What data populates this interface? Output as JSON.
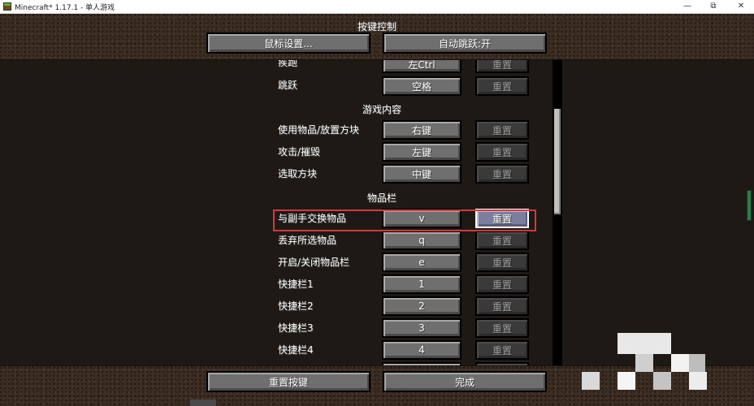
{
  "window": {
    "title": "Minecraft* 1.17.1 - 单人游戏",
    "minimize_glyph": "—",
    "maximize_glyph": "⧉",
    "close_glyph": "✕"
  },
  "screen": {
    "title": "按键控制",
    "mouse_settings_button": "鼠标设置...",
    "auto_jump_button": "自动跳跃:开"
  },
  "keybinds": {
    "reset_label": "重置",
    "rows": [
      {
        "action": "疾跑",
        "key": "左Ctrl"
      },
      {
        "action": "跳跃",
        "key": "空格"
      },
      {
        "action": "使用物品/放置方块",
        "key": "右键"
      },
      {
        "action": "攻击/摧毁",
        "key": "左键"
      },
      {
        "action": "选取方块",
        "key": "中键"
      },
      {
        "action": "与副手交换物品",
        "key": "v"
      },
      {
        "action": "丢弃所选物品",
        "key": "q"
      },
      {
        "action": "开启/关闭物品栏",
        "key": "e"
      },
      {
        "action": "快捷栏1",
        "key": "1"
      },
      {
        "action": "快捷栏2",
        "key": "2"
      },
      {
        "action": "快捷栏3",
        "key": "3"
      },
      {
        "action": "快捷栏4",
        "key": "4"
      }
    ],
    "categories": [
      "游戏内容",
      "物品栏"
    ]
  },
  "footer": {
    "reset_keys_button": "重置按键",
    "done_button": "完成"
  },
  "colors": {
    "highlight": "#d6383c",
    "button": "#6f6f6f",
    "button_disabled": "#3a3a3a"
  }
}
